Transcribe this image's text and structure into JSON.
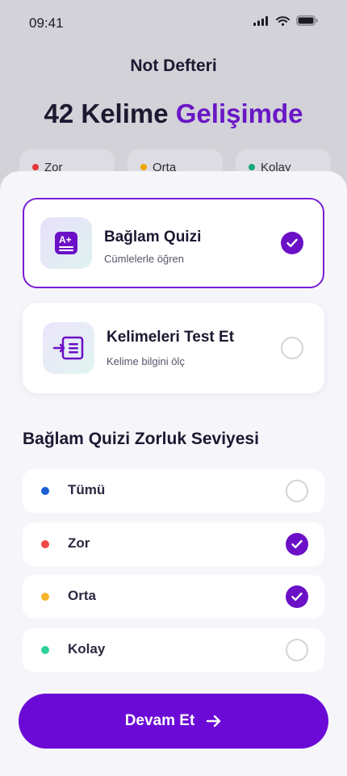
{
  "status_bar": {
    "time": "09:41",
    "icons": [
      "signal-icon",
      "wifi-icon",
      "battery-icon"
    ]
  },
  "background": {
    "title": "Not Defteri",
    "headline_count": "42 Kelime",
    "headline_accent": "Gelişimde",
    "chips": [
      {
        "label": "Zor",
        "color": "#e53935"
      },
      {
        "label": "Orta",
        "color": "#f0a500"
      },
      {
        "label": "Kolay",
        "color": "#18a57a"
      }
    ]
  },
  "modes": [
    {
      "title": "Bağlam Quizi",
      "subtitle": "Cümlelerle öğren",
      "icon": "a-plus-icon",
      "selected": true
    },
    {
      "title": "Kelimeleri Test Et",
      "subtitle": "Kelime bilgini ölç",
      "icon": "test-list-icon",
      "selected": false
    }
  ],
  "difficulty": {
    "title": "Bağlam Quizi Zorluk Seviyesi",
    "options": [
      {
        "label": "Tümü",
        "color": "#1e5fd6",
        "checked": false
      },
      {
        "label": "Zor",
        "color": "#f04747",
        "checked": true
      },
      {
        "label": "Orta",
        "color": "#f7b52c",
        "checked": true
      },
      {
        "label": "Kolay",
        "color": "#2fd19a",
        "checked": false
      }
    ]
  },
  "cta": {
    "label": "Devam Et"
  },
  "colors": {
    "accent": "#6b0ad6",
    "text": "#1b1930"
  }
}
